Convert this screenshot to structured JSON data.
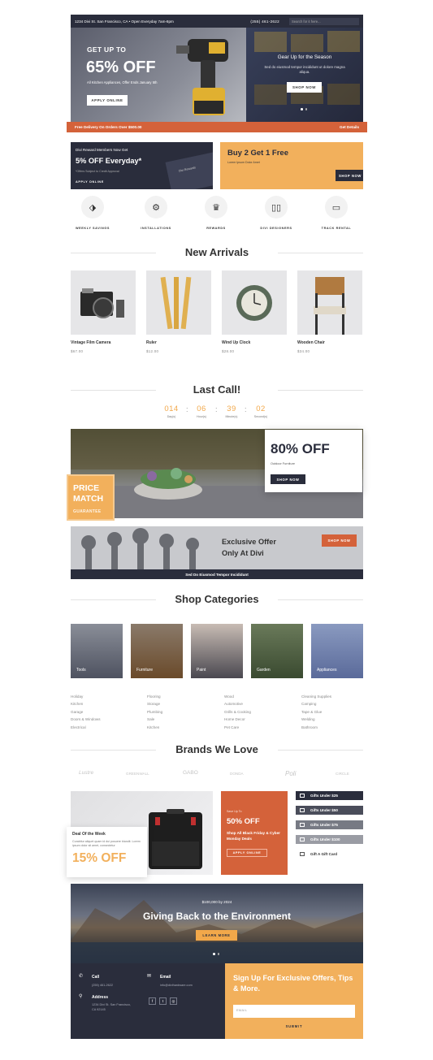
{
  "topbar": {
    "address": "1234 Divi St. San Francisco, CA • Open Everyday 7am-8pm",
    "phone": "(255) 461-2622",
    "search_placeholder": "Search for it here..."
  },
  "hero": {
    "kicker": "GET UP TO",
    "headline": "65% OFF",
    "subtext": "All Kitchen Appliances, Offer Ends January 5th",
    "cta": "APPLY ONLINE",
    "right_title": "Gear Up for the Season",
    "right_text": "Sed do eiusmod tempor incididunt ut dolore magna aliqua.",
    "right_cta": "SHOP NOW"
  },
  "promo_strip": {
    "left": "Free Delivery On Orders Over $500.00",
    "right": "Get Details"
  },
  "reward": {
    "kicker": "Divi Reward Members Now Get",
    "headline": "5% OFF Everyday*",
    "note": "*Offers Subject to Credit Approval",
    "cta": "APPLY ONLINE",
    "card_label": "Divi Rewards"
  },
  "buy2": {
    "headline": "Buy 2 Get 1 Free",
    "sub": "Lorem Ipsum Dolor Amet",
    "cta": "SHOP NOW"
  },
  "features": [
    {
      "icon": "tag-icon",
      "glyph": "⬗",
      "label": "WEEKLY SAVINGS"
    },
    {
      "icon": "wrench-icon",
      "glyph": "⚙",
      "label": "INSTALLATIONS"
    },
    {
      "icon": "trophy-icon",
      "glyph": "♛",
      "label": "REWARDS"
    },
    {
      "icon": "tools-icon",
      "glyph": "▯▯",
      "label": "DIVI DESIGNERS"
    },
    {
      "icon": "truck-icon",
      "glyph": "▭",
      "label": "TRACK RENTAL"
    }
  ],
  "new_arrivals": {
    "title": "New Arrivals",
    "items": [
      {
        "name": "Vintage Film Camera",
        "price": "$67.00"
      },
      {
        "name": "Ruler",
        "price": "$12.00"
      },
      {
        "name": "Wind Up Clock",
        "price": "$28.00"
      },
      {
        "name": "Wooden Chair",
        "price": "$34.00"
      }
    ]
  },
  "last_call": {
    "title": "Last Call!",
    "countdown": [
      {
        "value": "014",
        "unit": "Day(s)"
      },
      {
        "value": "06",
        "unit": "Hour(s)"
      },
      {
        "value": "39",
        "unit": "Minute(s)"
      },
      {
        "value": "02",
        "unit": "Second(s)"
      }
    ],
    "sep": ":"
  },
  "outdoor": {
    "headline": "80% OFF",
    "sub": "Outdoor Furniture",
    "cta": "SHOP NOW"
  },
  "price_match": {
    "line1": "PRICE",
    "line2": "MATCH",
    "line3": "GUARANTEE"
  },
  "exclusive": {
    "line1": "Exclusive Offer",
    "line2": "Only At Divi",
    "cta": "SHOP NOW",
    "strip": "Sed Do Eiusmod Tempor Incididunt"
  },
  "categories": {
    "title": "Shop Categories",
    "tiles": [
      "Tools",
      "Furniture",
      "Paint",
      "Garden",
      "Appliances"
    ],
    "lists": [
      [
        "Holiday",
        "Kitchen",
        "Garage",
        "Doors & Windows",
        "Electrical"
      ],
      [
        "Flooring",
        "Storage",
        "Plumbing",
        "Sale",
        "Kitchen"
      ],
      [
        "Wood",
        "Automotive",
        "Grills & Cooking",
        "Home Decor",
        "Pet Care"
      ],
      [
        "Cleaning Supplies",
        "Camping",
        "Tape & Glue",
        "Welding",
        "Bathroom"
      ]
    ]
  },
  "brands": {
    "title": "Brands We Love",
    "logos": [
      "Lustre",
      "GREENWALL",
      "GABO",
      "DONDA",
      "Poli",
      "CIRCLE"
    ]
  },
  "deal": {
    "title": "Deal Of the Week",
    "text": "Curabitur aliquet quam id dui posuere blandit. Lorem ipsum dolor sit amet, consectetur",
    "headline": "15% OFF"
  },
  "black_friday": {
    "kicker": "Save Up To",
    "headline": "50% OFF",
    "text": "Shop All Black Friday & Cyber Monday Deals",
    "cta": "APPLY ONLINE"
  },
  "gifts": [
    {
      "label": "Gifts Under $25",
      "color": "#2a2d3c"
    },
    {
      "label": "Gifts Under $50",
      "color": "#4a4d5a"
    },
    {
      "label": "Gifts Under $75",
      "color": "#777a84"
    },
    {
      "label": "Gifts Under $100",
      "color": "#9a9ca4"
    },
    {
      "label": "Gift A Gift Card",
      "color": "#ffffff"
    }
  ],
  "environment": {
    "kicker": "$100,000 by 2024",
    "headline": "Giving Back to the Environment",
    "cta": "LEARN MORE"
  },
  "footer": {
    "call_label": "Call",
    "call_value": "(255) 461-2622",
    "email_label": "Email",
    "email_value": "info@divihardware.com",
    "address_label": "Address",
    "address_value": "1234 Divi St. San Francisco, CA 92145",
    "social": [
      "f",
      "t",
      "◎"
    ]
  },
  "signup": {
    "headline": "Sign Up For Exclusive Offers, Tips & More.",
    "email_placeholder": "EMAIL",
    "submit": "SUBMIT"
  },
  "colors": {
    "navy": "#2a2d3c",
    "orange": "#d4623a",
    "gold": "#f2b05c"
  }
}
